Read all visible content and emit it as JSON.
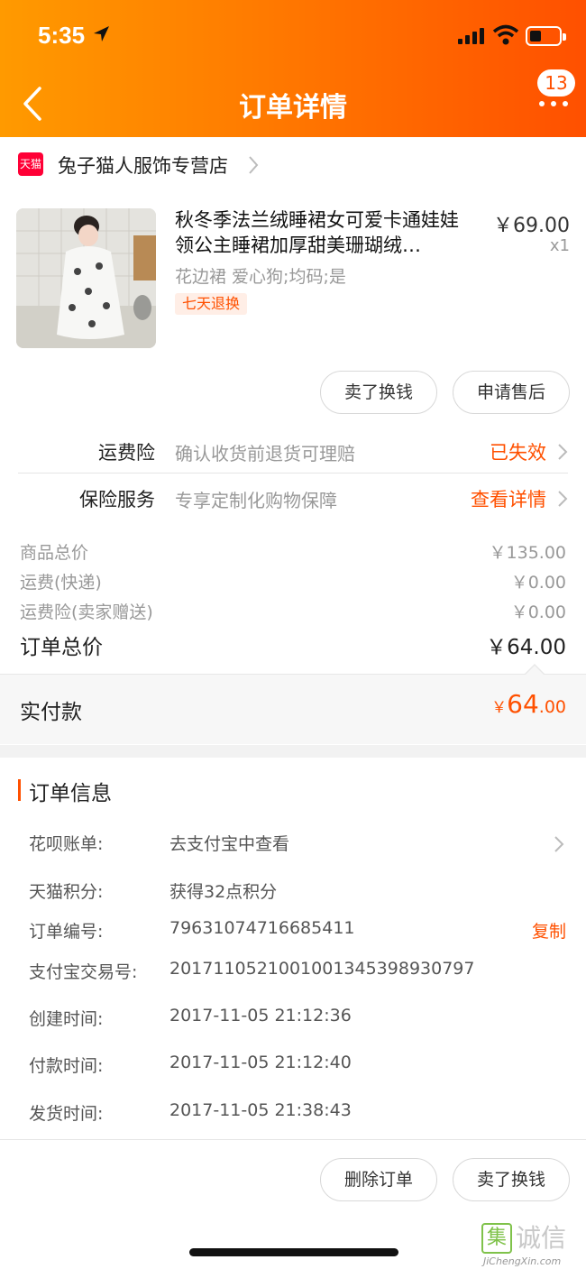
{
  "status_bar": {
    "time": "5:35"
  },
  "header": {
    "title": "订单详情",
    "badge_count": "13"
  },
  "store": {
    "logo_text": "天猫",
    "name": "兔子猫人服饰专营店"
  },
  "product": {
    "title": "秋冬季法兰绒睡裙女可爱卡通娃娃领公主睡裙加厚甜美珊瑚绒…",
    "spec": "花边裙 爱心狗;均码;是",
    "tag": "七天退换",
    "price": "￥69.00",
    "qty": "x1"
  },
  "product_actions": {
    "sell_label": "卖了换钱",
    "after_sale_label": "申请售后"
  },
  "services": [
    {
      "label": "运费险",
      "desc": "确认收货前退货可理赔",
      "status": "已失效"
    },
    {
      "label": "保险服务",
      "desc": "专享定制化购物保障",
      "status": "查看详情"
    }
  ],
  "summary": {
    "goods_total_label": "商品总价",
    "goods_total": "￥135.00",
    "shipping_label": "运费(快递)",
    "shipping": "￥0.00",
    "ins_label": "运费险(卖家赠送)",
    "ins": "￥0.00",
    "order_total_label": "订单总价",
    "order_total": "￥64.00"
  },
  "paid": {
    "label": "实付款",
    "currency": "￥",
    "integer": "64",
    "decimal": ".00"
  },
  "order_info": {
    "title": "订单信息",
    "rows": [
      {
        "key": "花呗账单:",
        "value": "去支付宝中查看"
      },
      {
        "key": "天猫积分:",
        "value": "获得32点积分"
      },
      {
        "key": "订单编号:",
        "value": "79631074716685411",
        "action": "复制"
      },
      {
        "key": "支付宝交易号:",
        "value": "2017110521001001345398930797"
      },
      {
        "key": "创建时间:",
        "value": "2017-11-05 21:12:36"
      },
      {
        "key": "付款时间:",
        "value": "2017-11-05 21:12:40"
      },
      {
        "key": "发货时间:",
        "value": "2017-11-05 21:38:43"
      }
    ]
  },
  "bottom_actions": {
    "delete_label": "删除订单",
    "sell_label": "卖了换钱"
  },
  "watermark": {
    "mark": "集",
    "text": "诚信",
    "sub": "JiChengXin.com"
  },
  "colors": {
    "accent": "#ff5000",
    "header_start": "#ff9a00",
    "header_end": "#ff5000"
  }
}
